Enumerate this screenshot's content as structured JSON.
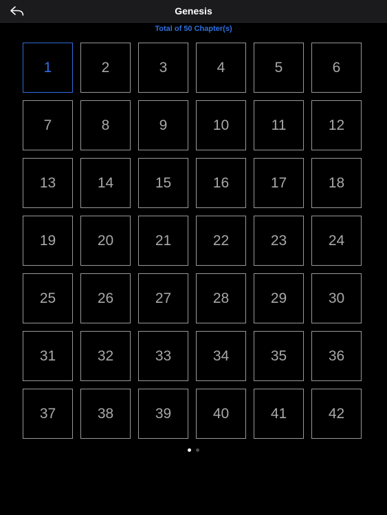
{
  "header": {
    "title": "Genesis",
    "back_icon": "back-arrow-icon"
  },
  "subtitle": "Total of 50 Chapter(s)",
  "colors": {
    "accent": "#2f6fe0",
    "cell_border": "#9a9a9a",
    "cell_text": "#a8a8a8",
    "background": "#000000",
    "navbar": "#1b1b1d"
  },
  "chapters": [
    "1",
    "2",
    "3",
    "4",
    "5",
    "6",
    "7",
    "8",
    "9",
    "10",
    "11",
    "12",
    "13",
    "14",
    "15",
    "16",
    "17",
    "18",
    "19",
    "20",
    "21",
    "22",
    "23",
    "24",
    "25",
    "26",
    "27",
    "28",
    "29",
    "30",
    "31",
    "32",
    "33",
    "34",
    "35",
    "36",
    "37",
    "38",
    "39",
    "40",
    "41",
    "42"
  ],
  "selected_chapter": "1",
  "pager": {
    "pages": 2,
    "current": 1
  }
}
